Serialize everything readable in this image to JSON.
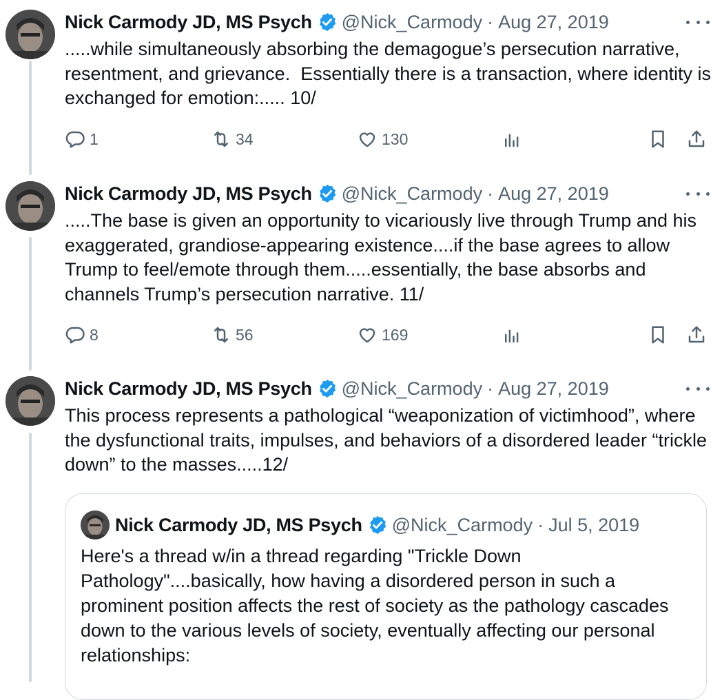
{
  "author": {
    "name": "Nick Carmody JD, MS Psych",
    "handle": "@Nick_Carmody",
    "verified_color": "#1d9bf0"
  },
  "tweets": [
    {
      "date": "Aug 27, 2019",
      "text": ".....while simultaneously absorbing the demagogue’s persecution narrative, resentment, and grievance.  Essentially there is a transaction, where identity is exchanged for emotion:..... 10/",
      "replies": "1",
      "retweets": "34",
      "likes": "130"
    },
    {
      "date": "Aug 27, 2019",
      "text": ".....The base is given an opportunity to vicariously live through Trump and his exaggerated, grandiose-appearing existence....if the base agrees to allow Trump to feel/emote through them.....essentially, the base absorbs and channels Trump’s persecution narrative. 11/",
      "replies": "8",
      "retweets": "56",
      "likes": "169"
    },
    {
      "date": "Aug 27, 2019",
      "text": "This process represents a pathological “weaponization of victimhood”, where the dysfunctional traits, impulses, and behaviors of a disordered leader “trickle down” to the masses.....12/"
    }
  ],
  "quoted_tweet": {
    "name": "Nick Carmody JD, MS Psych",
    "handle": "@Nick_Carmody",
    "date": "Jul 5, 2019",
    "text": "Here's a thread w/in a thread regarding \"Trickle Down Pathology\"....basically, how having a disordered person in such a prominent position affects the rest of society as the pathology cascades down to the various levels of society, eventually affecting our personal relationships:"
  },
  "icons": {
    "reply": "reply-icon",
    "retweet": "retweet-icon",
    "like": "heart-icon",
    "views": "views-icon",
    "bookmark": "bookmark-icon",
    "share": "share-icon",
    "more": "more-icon",
    "verified": "verified-badge-icon"
  }
}
